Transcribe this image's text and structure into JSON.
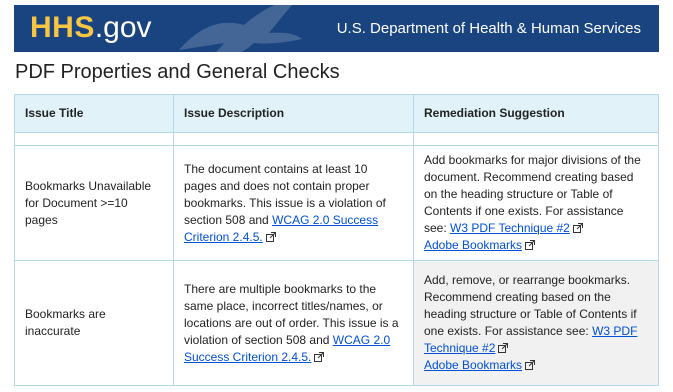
{
  "banner": {
    "logo_main": "HHS",
    "logo_suffix": ".gov",
    "department": "U.S. Department of Health & Human Services"
  },
  "page_title": "PDF Properties and General Checks",
  "table": {
    "headers": [
      "Issue Title",
      "Issue Description",
      "Remediation Suggestion"
    ],
    "rows": [
      {
        "title": "Bookmarks Unavailable for Document >=10 pages",
        "description_text": "The document contains at least 10 pages and does not contain proper bookmarks. This issue is a violation of section 508 and ",
        "description_link": "WCAG 2.0 Success Criterion 2.4.5.",
        "remediation_text": "Add bookmarks for major divisions of the document. Recommend creating based on the heading structure or Table of Contents if one exists. For assistance see: ",
        "link1": "W3 PDF Technique #2",
        "link2": "Adobe Bookmarks"
      },
      {
        "title": "Bookmarks are inaccurate",
        "description_text": "There are multiple bookmarks to the same place, incorrect titles/names, or locations are out of order. This issue is a violation of section 508 and ",
        "description_link": "WCAG 2.0 Success Criterion 2.4.5.",
        "remediation_text": "Add, remove, or rearrange bookmarks. Recommend creating based on the heading structure or Table of Contents if one exists. For assistance see: ",
        "link1": "W3 PDF Technique #2",
        "link2": "Adobe Bookmarks"
      }
    ]
  },
  "colors": {
    "banner": "#1a4480",
    "logo_accent": "#f9c642",
    "header_bg": "#e1f3f8",
    "link": "#0050d8"
  },
  "icons": [
    "hhs-eagle-icon",
    "external-link-icon"
  ]
}
